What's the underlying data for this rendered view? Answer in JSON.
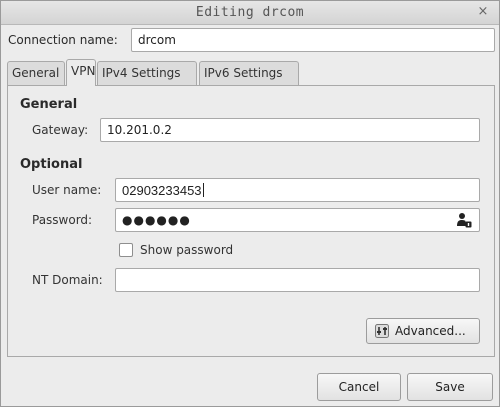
{
  "window": {
    "title": "Editing drcom",
    "close_glyph": "×"
  },
  "connection": {
    "label": "Connection name:",
    "value": "drcom"
  },
  "tabs": [
    {
      "label": "General",
      "active": false
    },
    {
      "label": "VPN",
      "active": true
    },
    {
      "label": "IPv4 Settings",
      "active": false
    },
    {
      "label": "IPv6 Settings",
      "active": false
    }
  ],
  "vpn": {
    "general_heading": "General",
    "gateway_label": "Gateway:",
    "gateway_value": "10.201.0.2",
    "optional_heading": "Optional",
    "username_label": "User name:",
    "username_value": "02903233453",
    "password_label": "Password:",
    "password_masked": "●●●●●●",
    "password_icon": "user-lock-icon",
    "show_password_label": "Show password",
    "show_password_checked": false,
    "nt_domain_label": "NT Domain:",
    "nt_domain_value": "",
    "advanced_label": "Advanced...",
    "advanced_icon": "settings-icon"
  },
  "footer": {
    "cancel_label": "Cancel",
    "save_label": "Save"
  }
}
